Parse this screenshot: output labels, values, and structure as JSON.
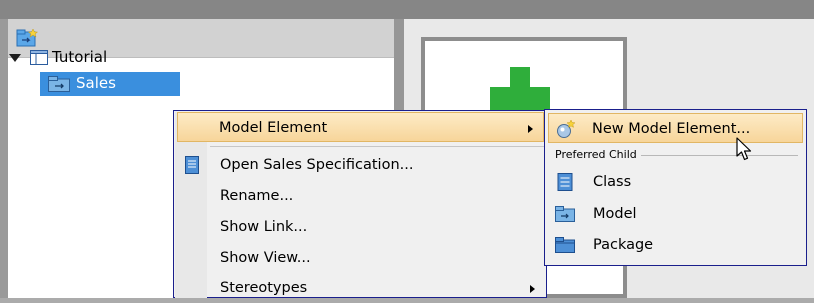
{
  "tree": {
    "nodes": [
      {
        "label": "Tutorial",
        "icon": "book-icon",
        "expanded": true
      },
      {
        "label": "Sales",
        "icon": "model-folder-icon",
        "selected": true
      }
    ]
  },
  "context_menu": {
    "items": [
      {
        "label": "Model Element",
        "has_submenu": true,
        "highlighted": true
      },
      {
        "label": "Open Sales Specification...",
        "icon": "specification-icon"
      },
      {
        "label": "Rename..."
      },
      {
        "label": "Show Link..."
      },
      {
        "label": "Show View..."
      },
      {
        "label": "Stereotypes",
        "has_submenu": true
      }
    ]
  },
  "submenu": {
    "new_item": "New Model Element...",
    "group_label": "Preferred Child",
    "children": [
      {
        "label": "Class",
        "icon": "class-icon"
      },
      {
        "label": "Model",
        "icon": "model-icon"
      },
      {
        "label": "Package",
        "icon": "package-icon"
      }
    ]
  },
  "colors": {
    "selection": "#3a8fde",
    "menu_border": "#1a1f8c",
    "menu_highlight": "#f7d59a",
    "diagram_green": "#2fae3b"
  }
}
